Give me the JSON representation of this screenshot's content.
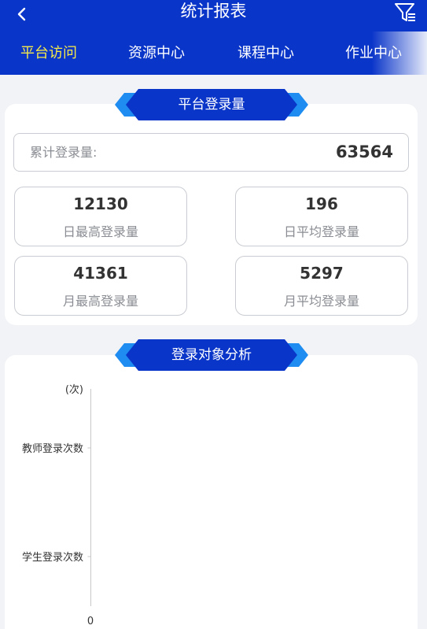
{
  "header": {
    "title": "统计报表",
    "tabs": [
      {
        "label": "平台访问",
        "active": true
      },
      {
        "label": "资源中心",
        "active": false
      },
      {
        "label": "课程中心",
        "active": false
      },
      {
        "label": "作业中心",
        "active": false
      }
    ]
  },
  "login_section": {
    "title": "平台登录量",
    "total_label": "累计登录量:",
    "total_value": "63564",
    "stats": [
      {
        "value": "12130",
        "label": "日最高登录量"
      },
      {
        "value": "196",
        "label": "日平均登录量"
      },
      {
        "value": "41361",
        "label": "月最高登录量"
      },
      {
        "value": "5297",
        "label": "月平均登录量"
      }
    ]
  },
  "object_section": {
    "title": "登录对象分析"
  },
  "chart_data": {
    "type": "bar",
    "orientation": "horizontal",
    "categories": [
      "教师登录次数",
      "学生登录次数"
    ],
    "values": [
      0,
      0
    ],
    "unit_label": "(次)",
    "x_tick_labels": [
      "0"
    ],
    "grid": false
  },
  "colors": {
    "header_bg": "#0a35c9",
    "active_tab": "#f5e94a",
    "ribbon_dark": "#0a35c9",
    "ribbon_light": "#1e8cf0"
  },
  "icons": {
    "back": "chevron-left-icon",
    "filter": "filter-icon"
  }
}
